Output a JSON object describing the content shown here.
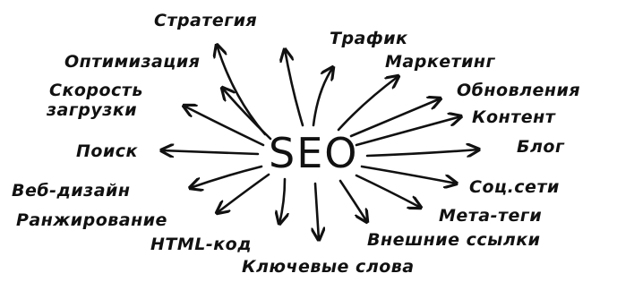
{
  "diagram": {
    "center": "SEO",
    "colors": {
      "ink": "#111111",
      "background": "#ffffff"
    },
    "labels": {
      "strategy": "Стратегия",
      "traffic": "Трафик",
      "optimization": "Оптимизация",
      "marketing": "Маркетинг",
      "load_speed_line1": "Скорость",
      "load_speed_line2": "загрузки",
      "updates": "Обновления",
      "content": "Контент",
      "search": "Поиск",
      "blog": "Блог",
      "web_design": "Веб-дизайн",
      "social": "Соц.сети",
      "ranking": "Ранжирование",
      "meta_tags": "Мета-теги",
      "html_code": "HTML-код",
      "backlinks": "Внешние ссылки",
      "keywords": "Ключевые слова"
    }
  }
}
